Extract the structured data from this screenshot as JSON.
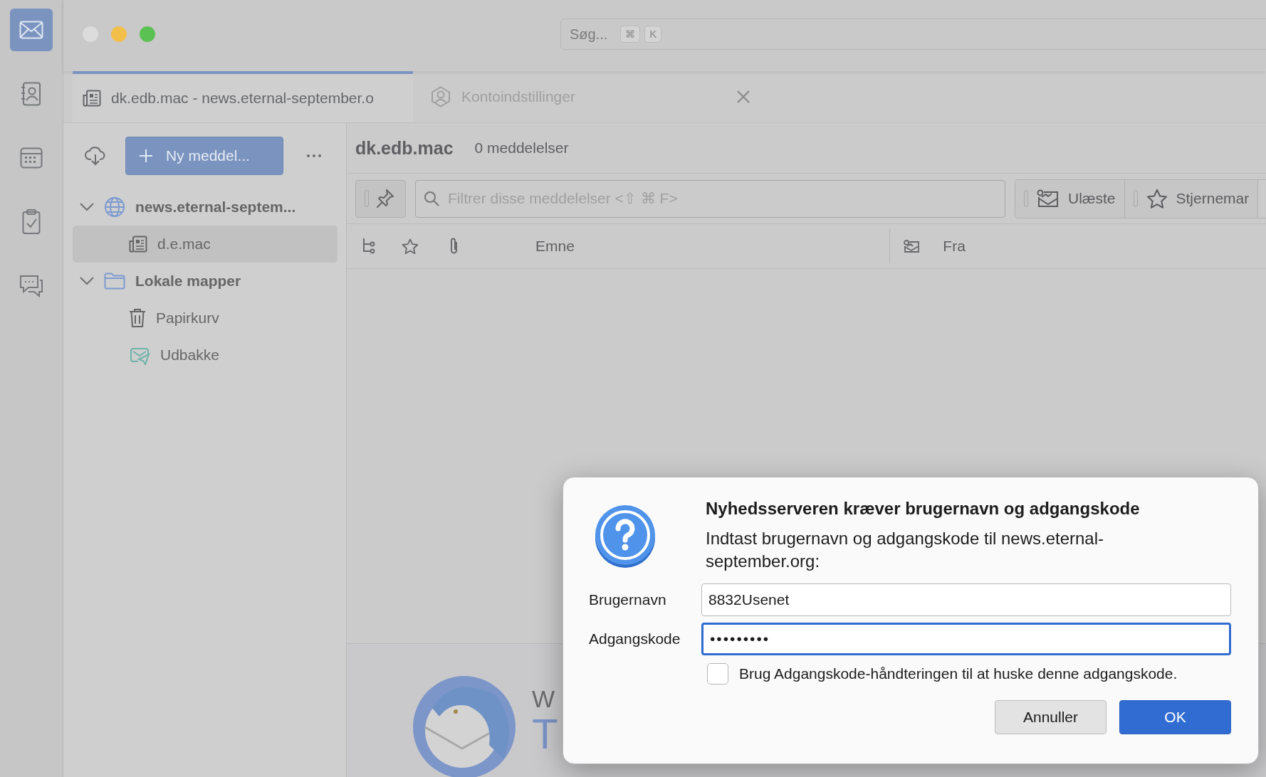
{
  "window": {
    "traffic_lights": [
      {
        "color": "#dcdcdc"
      },
      {
        "color": "#f2bf4b"
      },
      {
        "color": "#5cc153"
      }
    ]
  },
  "rail": {
    "items": [
      {
        "kind": "mail",
        "selected": true
      },
      {
        "kind": "contacts",
        "selected": false
      },
      {
        "kind": "calendar",
        "selected": false
      },
      {
        "kind": "tasks",
        "selected": false
      },
      {
        "kind": "chat",
        "selected": false
      }
    ]
  },
  "search": {
    "placeholder": "Søg...",
    "keys": [
      "⌘",
      "K"
    ]
  },
  "tabs": [
    {
      "kind": "folder",
      "label": "dk.edb.mac - news.eternal-september.o",
      "selected": true,
      "closable": false
    },
    {
      "kind": "account",
      "label": "Kontoindstillinger",
      "selected": false,
      "closable": true
    }
  ],
  "folder_pane": {
    "new_button": "Ny meddel...",
    "tree": [
      {
        "kind": "server",
        "label": "news.eternal-septem...",
        "expanded": true,
        "selected": false,
        "children": [
          {
            "kind": "newsgroup",
            "label": "d.e.mac",
            "selected": true
          }
        ]
      },
      {
        "kind": "local",
        "label": "Lokale mapper",
        "expanded": true,
        "selected": false,
        "children": [
          {
            "kind": "trash",
            "label": "Papirkurv",
            "selected": false
          },
          {
            "kind": "outbox",
            "label": "Udbakke",
            "selected": false
          }
        ]
      }
    ]
  },
  "message_pane": {
    "folder_name": "dk.edb.mac",
    "count": "0 meddelelser",
    "filter": {
      "placeholder": "Filtrer disse meddelelser <⇧ ⌘ F>"
    },
    "quick_filters": [
      {
        "kind": "unread",
        "label": "Ulæste"
      },
      {
        "kind": "starred",
        "label": "Stjernemar"
      }
    ],
    "columns": [
      {
        "kind": "thread"
      },
      {
        "kind": "star"
      },
      {
        "kind": "attachment"
      },
      {
        "kind": "subject",
        "label": "Emne"
      },
      {
        "kind": "correspondent",
        "label": "Fra"
      }
    ]
  },
  "welcome": {
    "heading": "W",
    "title": "T"
  },
  "dialog": {
    "title": "Nyhedsserveren kræver brugernavn og adgangskode",
    "message": "Indtast brugernavn og adgangskode til news.eternal-september.org:",
    "fields": [
      {
        "kind": "text",
        "label": "Brugernavn",
        "value": "8832Usenet",
        "focused": false
      },
      {
        "kind": "password",
        "label": "Adgangskode",
        "value": "•••••••••",
        "focused": true
      }
    ],
    "remember": {
      "label": "Brug Adgangskode-håndteringen til at huske denne adgangskode.",
      "checked": false
    },
    "buttons": [
      {
        "kind": "cancel",
        "label": "Annuller"
      },
      {
        "kind": "default",
        "label": "OK"
      }
    ]
  }
}
